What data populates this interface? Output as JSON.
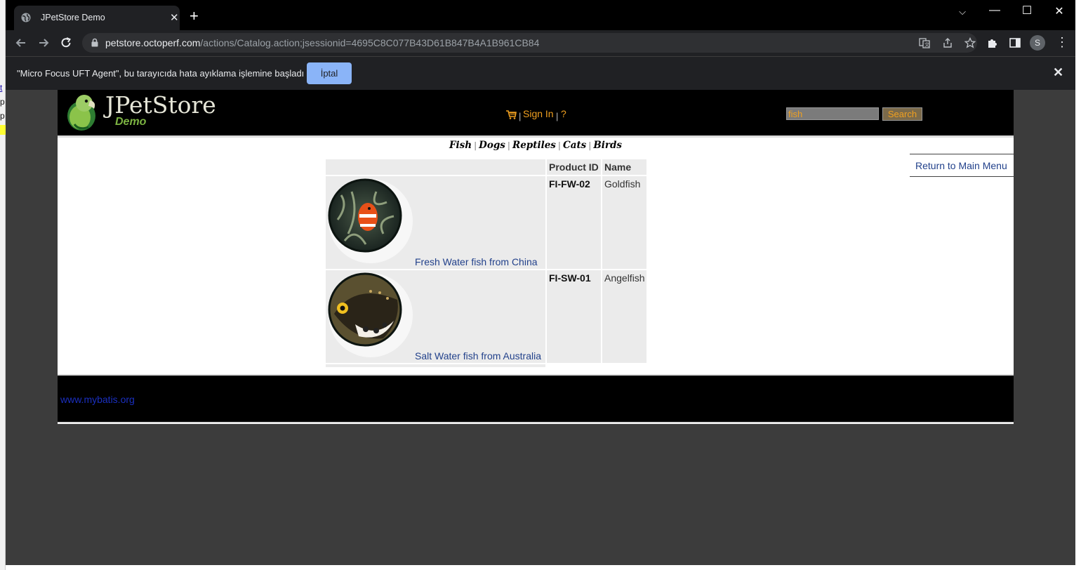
{
  "browser": {
    "tab_title": "JPetStore Demo",
    "url_host": "petstore.octoperf.com",
    "url_path": "/actions/Catalog.action;jsessionid=4695C8C077B43D61B847B4A1B961CB84",
    "profile_initial": "S"
  },
  "infobar": {
    "message": "\"Micro Focus UFT Agent\", bu tarayıcıda hata ayıklama işlemine başladı",
    "cancel_label": "İptal"
  },
  "header": {
    "logo_title": "JPetStore",
    "logo_subtitle": "Demo",
    "signin_label": "Sign In",
    "help_label": "?",
    "search_value": "fish",
    "search_button": "Search"
  },
  "quicklinks": [
    "Fish",
    "Dogs",
    "Reptiles",
    "Cats",
    "Birds"
  ],
  "sidebar": {
    "return_label": "Return to Main Menu"
  },
  "catalog": {
    "headers": {
      "image": "",
      "product_id": "Product ID",
      "name": "Name"
    },
    "rows": [
      {
        "description": "Fresh Water fish from China",
        "product_id": "FI-FW-02",
        "name": "Goldfish"
      },
      {
        "description": "Salt Water fish from Australia",
        "product_id": "FI-SW-01",
        "name": "Angelfish"
      }
    ]
  },
  "footer": {
    "link": "www.mybatis.org"
  },
  "colors": {
    "accent_orange": "#f0a020",
    "link_blue": "#22418b",
    "infobar_button": "#8ab4f8"
  }
}
